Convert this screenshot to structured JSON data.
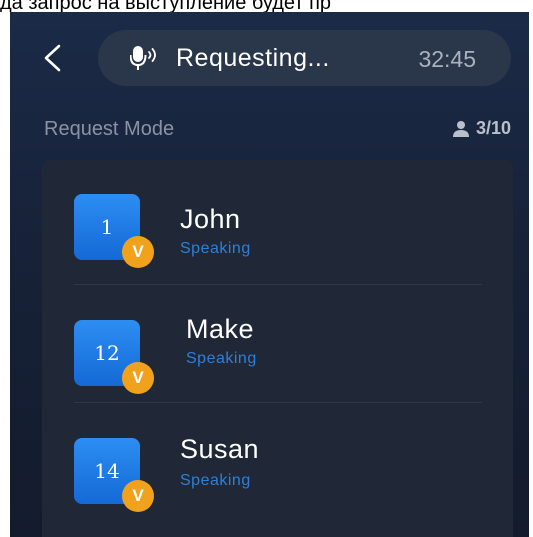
{
  "caption": "да запрос на выступление будет пр",
  "header": {
    "back_icon": "chevron-left-icon",
    "mic_icon": "microphone-sound-icon",
    "status_text": "Requesting...",
    "timer": "32:45"
  },
  "mode": {
    "label": "Request Mode",
    "count_icon": "person-icon",
    "count": "3/10"
  },
  "participants": [
    {
      "number": "1",
      "name": "John",
      "status": "Speaking",
      "badge": "V"
    },
    {
      "number": "12",
      "name": "Make",
      "status": "Speaking",
      "badge": "V"
    },
    {
      "number": "14",
      "name": "Susan",
      "status": "Speaking",
      "badge": "V"
    }
  ],
  "colors": {
    "background": "#172238",
    "pill": "#2a3649",
    "panel": "#202837",
    "avatar": "#1f7ae3",
    "badge": "#f0a21c",
    "status": "#2f7fd8"
  }
}
